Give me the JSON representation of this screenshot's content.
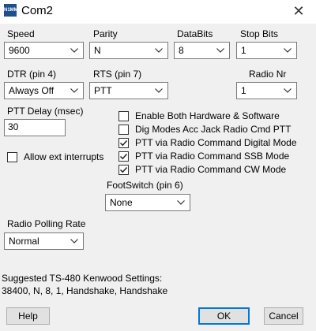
{
  "window": {
    "title": "Com2",
    "close_glyph": "✕"
  },
  "speed": {
    "label": "Speed",
    "value": "9600"
  },
  "parity": {
    "label": "Parity",
    "value": "N"
  },
  "databits": {
    "label": "DataBits",
    "value": "8"
  },
  "stopbits": {
    "label": "Stop Bits",
    "value": "1"
  },
  "dtr": {
    "label": "DTR (pin 4)",
    "value": "Always Off"
  },
  "rts": {
    "label": "RTS (pin 7)",
    "value": "PTT"
  },
  "radio_nr": {
    "label": "Radio Nr",
    "value": "1"
  },
  "ptt_delay": {
    "label": "PTT Delay  (msec)",
    "value": "30"
  },
  "checkboxes": [
    {
      "label": "Enable Both Hardware & Software",
      "checked": false
    },
    {
      "label": "Dig Modes Acc Jack Radio Cmd PTT",
      "checked": false
    },
    {
      "label": "PTT via Radio Command Digital Mode",
      "checked": true
    },
    {
      "label": "PTT via Radio Command SSB Mode",
      "checked": true
    },
    {
      "label": "PTT via Radio Command CW Mode",
      "checked": true
    }
  ],
  "allow_ext_interrupts": {
    "label": "Allow ext interrupts",
    "checked": false
  },
  "footswitch": {
    "label": "FootSwitch (pin 6)",
    "value": "None"
  },
  "polling_rate": {
    "label": "Radio Polling Rate",
    "value": "Normal"
  },
  "suggested": {
    "line1": "Suggested TS-480 Kenwood Settings:",
    "line2": "38400, N, 8, 1, Handshake, Handshake"
  },
  "buttons": {
    "help": "Help",
    "ok": "OK",
    "cancel": "Cancel"
  },
  "colors": {
    "accent": "#0078d7",
    "background": "#f0f0f0"
  }
}
